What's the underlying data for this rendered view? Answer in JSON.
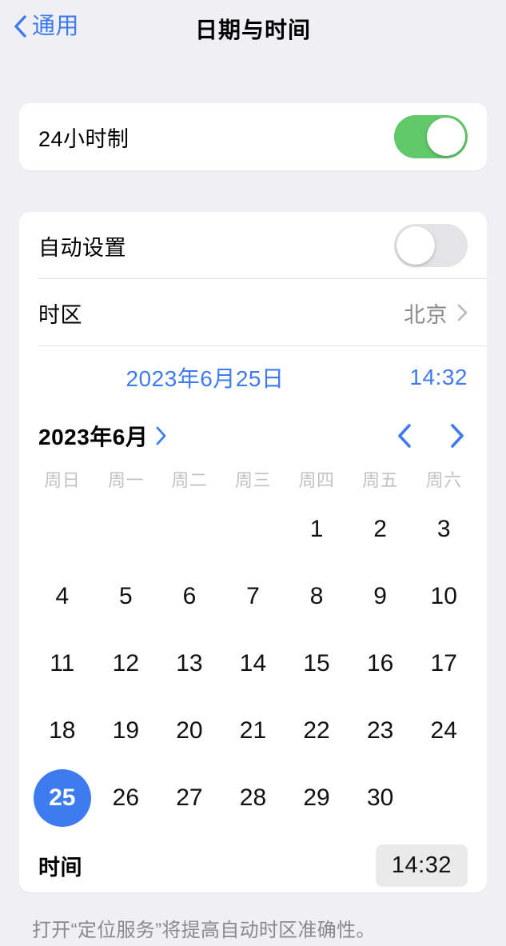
{
  "nav": {
    "back_label": "通用",
    "back_icon": "chevron-left-icon",
    "title": "日期与时间"
  },
  "colors": {
    "accent_blue": "#3E7BF0",
    "toggle_on_green": "#61C86B",
    "toggle_off_gray": "#E4E4E7",
    "page_background": "#F0F0F4",
    "card_background": "#FFFFFF",
    "secondary_text": "#8A8A8E"
  },
  "hour_format_section": {
    "label": "24小时制",
    "toggle_state": "on"
  },
  "main_section": {
    "auto_set": {
      "label": "自动设置",
      "toggle_state": "off"
    },
    "time_zone": {
      "label": "时区",
      "value": "北京",
      "disclosure_icon": "chevron-right-icon"
    },
    "datetime_display": {
      "date": "2023年6月25日",
      "time": "14:32"
    },
    "time_row": {
      "label": "时间",
      "value": "14:32"
    }
  },
  "calendar": {
    "month_label": "2023年6月",
    "month_chevron_icon": "chevron-right-icon",
    "prev_icon": "chevron-left-icon",
    "next_icon": "chevron-right-icon",
    "weekdays": [
      "周日",
      "周一",
      "周二",
      "周三",
      "周四",
      "周五",
      "周六"
    ],
    "selected_day": 25,
    "weeks": [
      [
        "",
        "",
        "",
        "",
        "1",
        "2",
        "3"
      ],
      [
        "4",
        "5",
        "6",
        "7",
        "8",
        "9",
        "10"
      ],
      [
        "11",
        "12",
        "13",
        "14",
        "15",
        "16",
        "17"
      ],
      [
        "18",
        "19",
        "20",
        "21",
        "22",
        "23",
        "24"
      ],
      [
        "25",
        "26",
        "27",
        "28",
        "29",
        "30",
        ""
      ]
    ]
  },
  "footer": {
    "note": "打开“定位服务”将提高自动时区准确性。"
  }
}
